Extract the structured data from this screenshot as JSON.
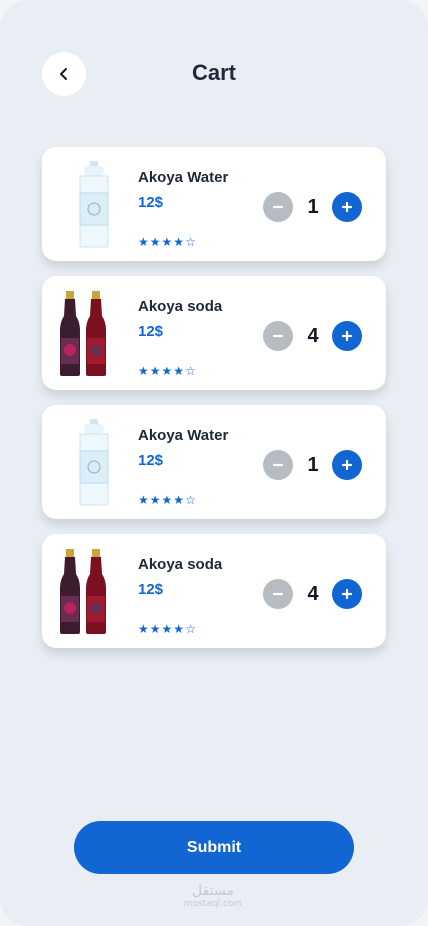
{
  "header": {
    "title": "Cart",
    "back_icon": "chevron-left-icon"
  },
  "cart": {
    "items": [
      {
        "name": "Akoya Water",
        "price": "12$",
        "quantity": "1",
        "rating": 4,
        "rating_max": 5,
        "image": "water-bottle"
      },
      {
        "name": "Akoya soda",
        "price": "12$",
        "quantity": "4",
        "rating": 4,
        "rating_max": 5,
        "image": "soda-bottles"
      },
      {
        "name": "Akoya Water",
        "price": "12$",
        "quantity": "1",
        "rating": 4,
        "rating_max": 5,
        "image": "water-bottle"
      },
      {
        "name": "Akoya soda",
        "price": "12$",
        "quantity": "4",
        "rating": 4,
        "rating_max": 5,
        "image": "soda-bottles"
      }
    ]
  },
  "footer": {
    "submit_label": "Submit",
    "watermark_arabic": "مستقل",
    "watermark_latin": "mostaql.com"
  },
  "colors": {
    "accent": "#1166d4",
    "muted": "#b7bcc2",
    "background": "#e8eef3",
    "card": "#ffffff"
  }
}
